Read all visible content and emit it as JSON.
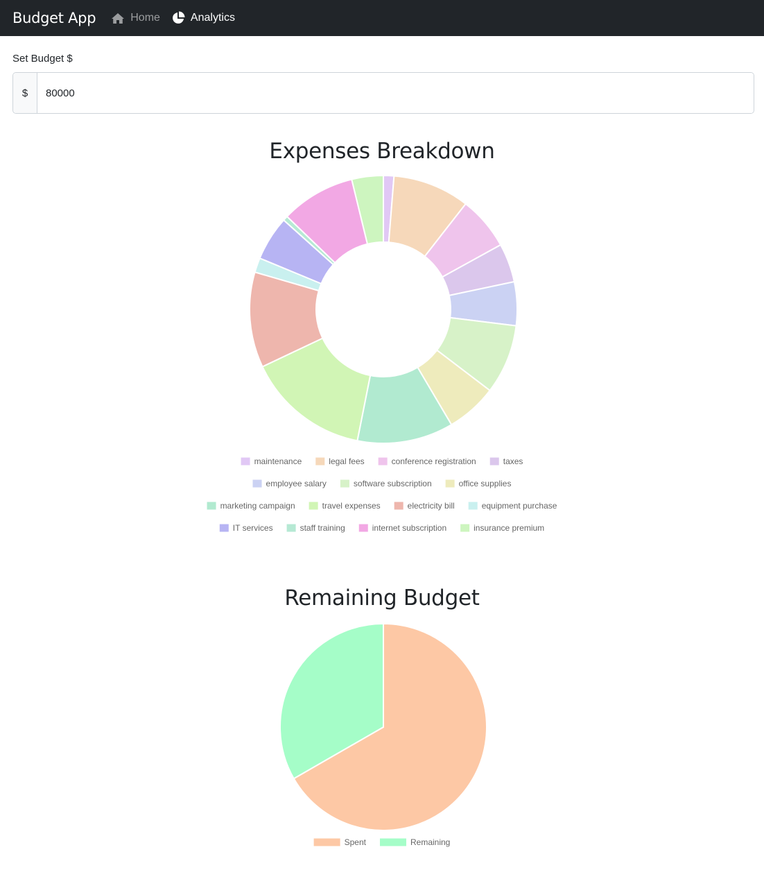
{
  "navbar": {
    "brand": "Budget App",
    "links": [
      {
        "label": "Home",
        "icon": "home-icon"
      },
      {
        "label": "Analytics",
        "icon": "pie-chart-icon",
        "active": true
      }
    ]
  },
  "budget": {
    "label": "Set Budget $",
    "prefix": "$",
    "value": "80000"
  },
  "chart_data": [
    {
      "type": "pie",
      "variant": "doughnut",
      "title": "Expenses Breakdown",
      "categories": [
        "maintenance",
        "legal fees",
        "conference registration",
        "taxes",
        "employee salary",
        "software subscription",
        "office supplies",
        "marketing campaign",
        "travel expenses",
        "electricity bill",
        "equipment purchase",
        "IT services",
        "staff training",
        "internet subscription",
        "insurance premium"
      ],
      "values": [
        1.3,
        9.5,
        6.6,
        4.8,
        5.4,
        8.6,
        6.3,
        11.9,
        15.2,
        11.8,
        1.8,
        5.5,
        0.6,
        9.2,
        3.9
      ],
      "colors": [
        "#e1c8f5",
        "#f6d8ba",
        "#efc4ec",
        "#dbc7ec",
        "#cbd2f3",
        "#d7f2c8",
        "#eeebbc",
        "#b1ead0",
        "#d1f5b5",
        "#eeb6ad",
        "#c9f0ef",
        "#b7b4f3",
        "#b6e9d4",
        "#f2a8e4",
        "#cdf5bf"
      ],
      "legend": "bottom"
    },
    {
      "type": "pie",
      "title": "Remaining Budget",
      "categories": [
        "Spent",
        "Remaining"
      ],
      "values": [
        66.7,
        33.3
      ],
      "colors": [
        "#fdc8a5",
        "#a5fdc8"
      ],
      "legend": "bottom"
    }
  ]
}
